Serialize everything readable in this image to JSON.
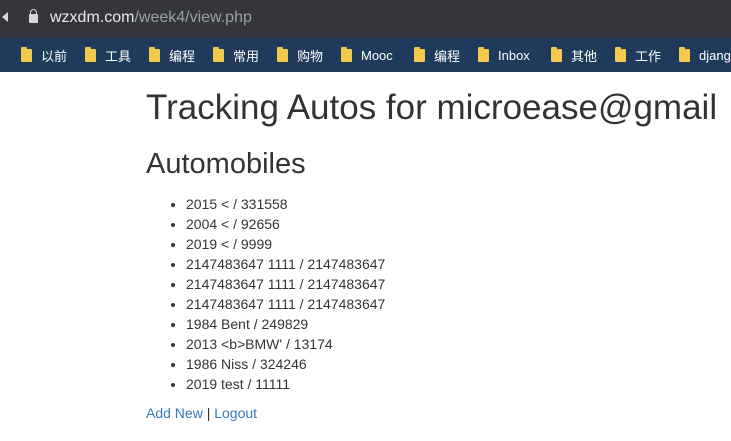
{
  "browser": {
    "url_host": "wzxdm.com",
    "url_path": "/week4/view.php"
  },
  "bookmarks": [
    "以前",
    "工具",
    "编程",
    "常用",
    "购物",
    "Mooc",
    "编程",
    "Inbox",
    "其他",
    "工作",
    "djang"
  ],
  "page": {
    "title": "Tracking Autos for microease@gmail",
    "section_heading": "Automobiles",
    "autos": [
      "2015 < / 331558",
      "2004 < / 92656",
      "2019 < / 9999",
      "2147483647 1111 / 2147483647",
      "2147483647 1111 / 2147483647",
      "2147483647 1111 / 2147483647",
      "1984 Bent / 249829",
      "2013 <b>BMW' / 13174",
      "1986 Niss / 324246",
      "2019 test / 11111"
    ],
    "links": {
      "add_new": "Add New",
      "separator": "|",
      "logout": "Logout"
    }
  }
}
